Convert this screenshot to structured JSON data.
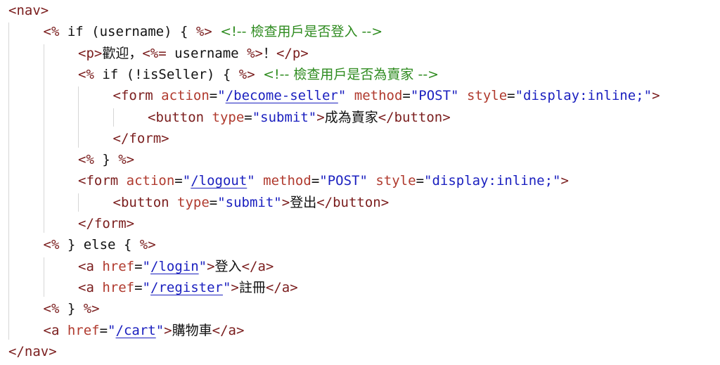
{
  "lines": [
    {
      "indent": 0,
      "tokens": [
        {
          "c": "tag",
          "t": "<nav>"
        }
      ]
    },
    {
      "indent": 1,
      "tokens": [
        {
          "c": "ejs",
          "t": "<%"
        },
        {
          "c": "op",
          "t": " if (username) { "
        },
        {
          "c": "ejs",
          "t": "%>"
        },
        {
          "c": "op",
          "t": " "
        },
        {
          "c": "cm",
          "t": "<!-- 檢查用戶是否登入 -->"
        }
      ]
    },
    {
      "indent": 2,
      "tokens": [
        {
          "c": "tag",
          "t": "<p>"
        },
        {
          "c": "txt",
          "t": "歡迎，"
        },
        {
          "c": "ejs",
          "t": "<%="
        },
        {
          "c": "op",
          "t": " username "
        },
        {
          "c": "ejs",
          "t": "%>"
        },
        {
          "c": "txt",
          "t": "！"
        },
        {
          "c": "tag",
          "t": "</p>"
        }
      ]
    },
    {
      "indent": 2,
      "tokens": [
        {
          "c": "ejs",
          "t": "<%"
        },
        {
          "c": "op",
          "t": " if (!isSeller) { "
        },
        {
          "c": "ejs",
          "t": "%>"
        },
        {
          "c": "op",
          "t": " "
        },
        {
          "c": "cm",
          "t": "<!-- 檢查用戶是否為賣家 -->"
        }
      ]
    },
    {
      "indent": 3,
      "tokens": [
        {
          "c": "tag",
          "t": "<form "
        },
        {
          "c": "attr",
          "t": "action"
        },
        {
          "c": "op",
          "t": "="
        },
        {
          "c": "val",
          "t": "\""
        },
        {
          "c": "url",
          "t": "/become-seller"
        },
        {
          "c": "val",
          "t": "\""
        },
        {
          "c": "op",
          "t": " "
        },
        {
          "c": "attr",
          "t": "method"
        },
        {
          "c": "op",
          "t": "="
        },
        {
          "c": "val",
          "t": "\"POST\""
        },
        {
          "c": "op",
          "t": " "
        },
        {
          "c": "attr",
          "t": "style"
        },
        {
          "c": "op",
          "t": "="
        },
        {
          "c": "val",
          "t": "\"display:inline;\""
        },
        {
          "c": "tag",
          "t": ">"
        }
      ]
    },
    {
      "indent": 4,
      "tokens": [
        {
          "c": "tag",
          "t": "<button "
        },
        {
          "c": "attr",
          "t": "type"
        },
        {
          "c": "op",
          "t": "="
        },
        {
          "c": "val",
          "t": "\"submit\""
        },
        {
          "c": "tag",
          "t": ">"
        },
        {
          "c": "txt",
          "t": "成為賣家"
        },
        {
          "c": "tag",
          "t": "</button>"
        }
      ]
    },
    {
      "indent": 3,
      "tokens": [
        {
          "c": "tag",
          "t": "</form>"
        }
      ]
    },
    {
      "indent": 2,
      "tokens": [
        {
          "c": "ejs",
          "t": "<%"
        },
        {
          "c": "op",
          "t": " } "
        },
        {
          "c": "ejs",
          "t": "%>"
        }
      ]
    },
    {
      "indent": 2,
      "tokens": [
        {
          "c": "tag",
          "t": "<form "
        },
        {
          "c": "attr",
          "t": "action"
        },
        {
          "c": "op",
          "t": "="
        },
        {
          "c": "val",
          "t": "\""
        },
        {
          "c": "url",
          "t": "/logout"
        },
        {
          "c": "val",
          "t": "\""
        },
        {
          "c": "op",
          "t": " "
        },
        {
          "c": "attr",
          "t": "method"
        },
        {
          "c": "op",
          "t": "="
        },
        {
          "c": "val",
          "t": "\"POST\""
        },
        {
          "c": "op",
          "t": " "
        },
        {
          "c": "attr",
          "t": "style"
        },
        {
          "c": "op",
          "t": "="
        },
        {
          "c": "val",
          "t": "\"display:inline;\""
        },
        {
          "c": "tag",
          "t": ">"
        }
      ]
    },
    {
      "indent": 3,
      "tokens": [
        {
          "c": "tag",
          "t": "<button "
        },
        {
          "c": "attr",
          "t": "type"
        },
        {
          "c": "op",
          "t": "="
        },
        {
          "c": "val",
          "t": "\"submit\""
        },
        {
          "c": "tag",
          "t": ">"
        },
        {
          "c": "txt",
          "t": "登出"
        },
        {
          "c": "tag",
          "t": "</button>"
        }
      ]
    },
    {
      "indent": 2,
      "tokens": [
        {
          "c": "tag",
          "t": "</form>"
        }
      ]
    },
    {
      "indent": 1,
      "tokens": [
        {
          "c": "ejs",
          "t": "<%"
        },
        {
          "c": "op",
          "t": " } else { "
        },
        {
          "c": "ejs",
          "t": "%>"
        }
      ]
    },
    {
      "indent": 2,
      "tokens": [
        {
          "c": "tag",
          "t": "<a "
        },
        {
          "c": "attr",
          "t": "href"
        },
        {
          "c": "op",
          "t": "="
        },
        {
          "c": "val",
          "t": "\""
        },
        {
          "c": "url",
          "t": "/login"
        },
        {
          "c": "val",
          "t": "\""
        },
        {
          "c": "tag",
          "t": ">"
        },
        {
          "c": "txt",
          "t": "登入"
        },
        {
          "c": "tag",
          "t": "</a>"
        }
      ]
    },
    {
      "indent": 2,
      "tokens": [
        {
          "c": "tag",
          "t": "<a "
        },
        {
          "c": "attr",
          "t": "href"
        },
        {
          "c": "op",
          "t": "="
        },
        {
          "c": "val",
          "t": "\""
        },
        {
          "c": "url",
          "t": "/register"
        },
        {
          "c": "val",
          "t": "\""
        },
        {
          "c": "tag",
          "t": ">"
        },
        {
          "c": "txt",
          "t": "註冊"
        },
        {
          "c": "tag",
          "t": "</a>"
        }
      ]
    },
    {
      "indent": 1,
      "tokens": [
        {
          "c": "ejs",
          "t": "<%"
        },
        {
          "c": "op",
          "t": " } "
        },
        {
          "c": "ejs",
          "t": "%>"
        }
      ]
    },
    {
      "indent": 1,
      "tokens": [
        {
          "c": "tag",
          "t": "<a "
        },
        {
          "c": "attr",
          "t": "href"
        },
        {
          "c": "op",
          "t": "="
        },
        {
          "c": "val",
          "t": "\""
        },
        {
          "c": "url",
          "t": "/cart"
        },
        {
          "c": "val",
          "t": "\""
        },
        {
          "c": "tag",
          "t": ">"
        },
        {
          "c": "txt",
          "t": "購物車"
        },
        {
          "c": "tag",
          "t": "</a>"
        }
      ]
    },
    {
      "indent": 0,
      "tokens": [
        {
          "c": "tag",
          "t": "</nav>"
        }
      ]
    }
  ],
  "colors": {
    "tag": "#7a1d1d",
    "attribute": "#b03a2e",
    "string": "#1a1fbf",
    "comment": "#2e8b1f",
    "text": "#111111",
    "indent_guide": "#d6d6d6",
    "background": "#ffffff"
  }
}
